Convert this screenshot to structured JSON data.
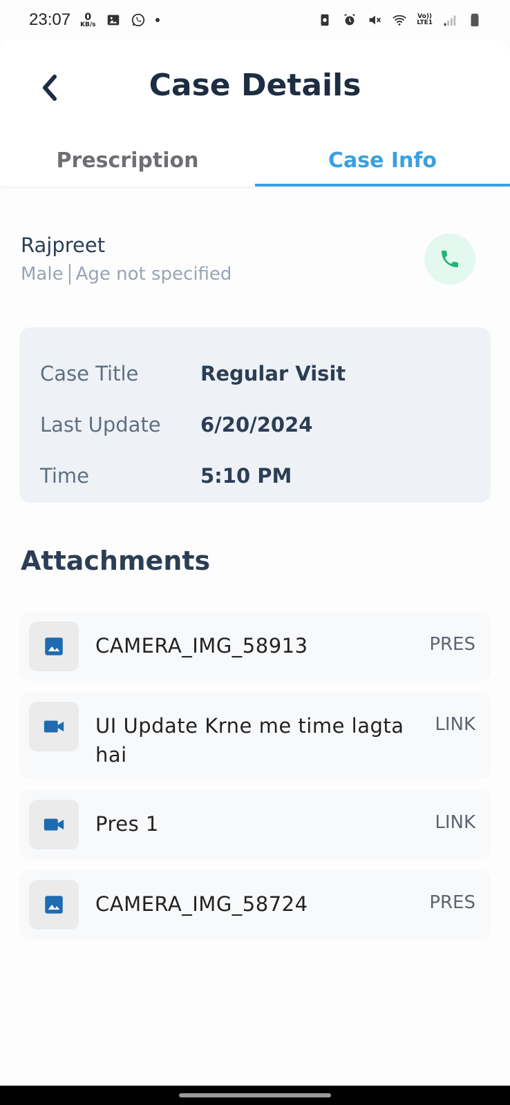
{
  "status_bar": {
    "time": "23:07",
    "speed_value": "0",
    "speed_unit": "KB/s",
    "network_label_top": "Vo))",
    "network_label_bottom": "LTE1"
  },
  "header": {
    "title": "Case Details",
    "tabs": [
      {
        "label": "Prescription",
        "active": false
      },
      {
        "label": "Case Info",
        "active": true
      }
    ]
  },
  "patient": {
    "name": "Rajpreet",
    "gender": "Male",
    "age": "Age not specified"
  },
  "case": {
    "rows": [
      {
        "label": "Case Title",
        "value": "Regular Visit"
      },
      {
        "label": "Last Update",
        "value": "6/20/2024"
      },
      {
        "label": "Time",
        "value": "5:10 PM"
      }
    ]
  },
  "attachments": {
    "heading": "Attachments",
    "items": [
      {
        "name": "CAMERA_IMG_58913",
        "type": "PRES",
        "icon": "image-icon"
      },
      {
        "name": "UI Update Krne me time lagta hai",
        "type": "LINK",
        "icon": "video-icon"
      },
      {
        "name": "Pres 1",
        "type": "LINK",
        "icon": "video-icon"
      },
      {
        "name": "CAMERA_IMG_58724",
        "type": "PRES",
        "icon": "image-icon"
      }
    ]
  },
  "colors": {
    "accent": "#3aa0e0",
    "call_green": "#1fb574",
    "icon_blue": "#1e6bb0",
    "card_bg": "#eef2f7"
  }
}
